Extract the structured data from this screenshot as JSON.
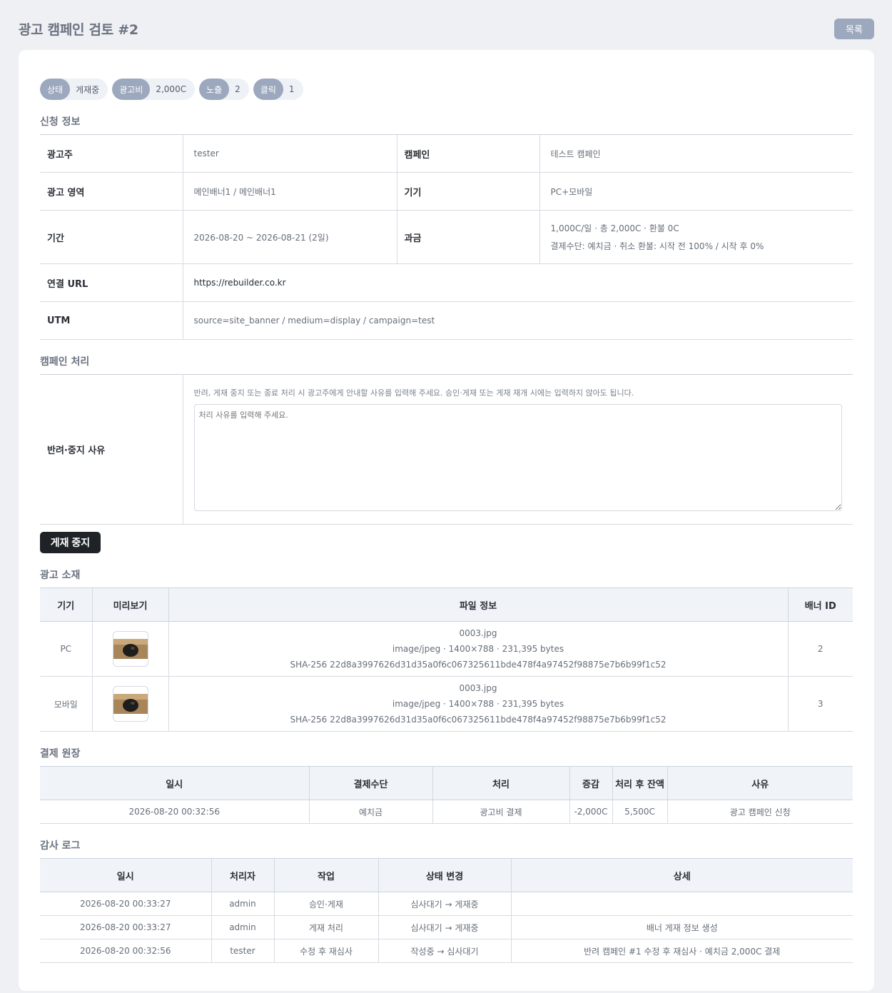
{
  "header": {
    "title": "광고 캠페인 검토 #2",
    "list_button": "목록"
  },
  "badges": [
    {
      "key": "상태",
      "value": "게재중"
    },
    {
      "key": "광고비",
      "value": "2,000C"
    },
    {
      "key": "노출",
      "value": "2"
    },
    {
      "key": "클릭",
      "value": "1"
    }
  ],
  "application": {
    "title": "신청 정보",
    "advertiser_label": "광고주",
    "advertiser": "tester",
    "campaign_label": "캠페인",
    "campaign": "테스트 캠페인",
    "area_label": "광고 영역",
    "area": "메인배너1 / 메인배너1",
    "device_label": "기기",
    "device": "PC+모바일",
    "period_label": "기간",
    "period": "2026-08-20 ~ 2026-08-21 (2일)",
    "billing_label": "과금",
    "billing_line1": "1,000C/일 · 총 2,000C · 환불 0C",
    "billing_line2": "결제수단: 예치금 · 취소 환불: 시작 전 100% / 시작 후 0%",
    "url_label": "연결 URL",
    "url": "https://rebuilder.co.kr",
    "utm_label": "UTM",
    "utm": "source=site_banner / medium=display / campaign=test"
  },
  "processing": {
    "title": "캠페인 처리",
    "reason_label": "반려·중지 사유",
    "hint": "반려, 게재 중지 또는 종료 처리 시 광고주에게 안내할 사유를 입력해 주세요. 승인·게재 또는 게재 재개 시에는 입력하지 않아도 됩니다.",
    "placeholder": "처리 사유를 입력해 주세요.",
    "stop_button": "게재 중지"
  },
  "creatives": {
    "title": "광고 소재",
    "headers": [
      "기기",
      "미리보기",
      "파일 정보",
      "배너 ID"
    ],
    "rows": [
      {
        "device": "PC",
        "filename": "0003.jpg",
        "meta": "image/jpeg · 1400×788 · 231,395 bytes",
        "hash": "SHA-256 22d8a3997626d31d35a0f6c067325611bde478f4a97452f98875e7b6b99f1c52",
        "banner_id": "2"
      },
      {
        "device": "모바일",
        "filename": "0003.jpg",
        "meta": "image/jpeg · 1400×788 · 231,395 bytes",
        "hash": "SHA-256 22d8a3997626d31d35a0f6c067325611bde478f4a97452f98875e7b6b99f1c52",
        "banner_id": "3"
      }
    ]
  },
  "ledger": {
    "title": "결제 원장",
    "headers": [
      "일시",
      "결제수단",
      "처리",
      "증감",
      "처리 후 잔액",
      "사유"
    ],
    "rows": [
      {
        "date": "2026-08-20 00:32:56",
        "method": "예치금",
        "action": "광고비 결제",
        "delta": "-2,000C",
        "balance": "5,500C",
        "reason": "광고 캠페인 신청"
      }
    ]
  },
  "audit": {
    "title": "감사 로그",
    "headers": [
      "일시",
      "처리자",
      "작업",
      "상태 변경",
      "상세"
    ],
    "rows": [
      {
        "date": "2026-08-20 00:33:27",
        "actor": "admin",
        "action": "승인·게재",
        "status": "심사대기 → 게재중",
        "detail": ""
      },
      {
        "date": "2026-08-20 00:33:27",
        "actor": "admin",
        "action": "게재 처리",
        "status": "심사대기 → 게재중",
        "detail": "배너 게재 정보 생성"
      },
      {
        "date": "2026-08-20 00:32:56",
        "actor": "tester",
        "action": "수정 후 재심사",
        "status": "작성중 → 심사대기",
        "detail": "반려 캠페인 #1 수정 후 재심사 · 예치금 2,000C 결제"
      }
    ]
  }
}
